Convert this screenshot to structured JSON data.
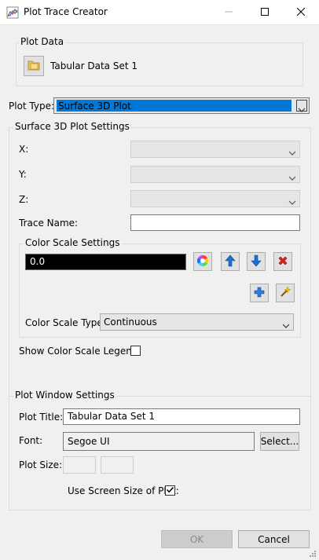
{
  "window": {
    "title": "Plot Trace Creator",
    "icon": "chart-icon",
    "controls": {
      "minimize": "minimize-icon",
      "maximize": "maximize-icon",
      "close": "close-icon"
    }
  },
  "plot_data": {
    "group_label": "Plot Data",
    "source_label": "Tabular Data Set 1",
    "source_icon": "folder-icon"
  },
  "plot_type": {
    "label": "Plot Type:",
    "value": "Surface 3D Plot"
  },
  "surface_settings": {
    "group_label": "Surface 3D Plot Settings",
    "x_label": "X:",
    "y_label": "Y:",
    "z_label": "Z:",
    "x_value": "",
    "y_value": "",
    "z_value": "",
    "trace_name_label": "Trace Name:",
    "trace_name_value": ""
  },
  "color_scale": {
    "group_label": "Color Scale Settings",
    "current_value": "0.0",
    "type_label": "Color Scale Type:",
    "type_value": "Continuous",
    "icons": {
      "color_picker": "color-wheel-icon",
      "move_up": "arrow-up-icon",
      "move_down": "arrow-down-icon",
      "remove": "red-x-icon",
      "add": "plus-icon",
      "auto": "magic-wand-icon"
    }
  },
  "legend": {
    "label": "Show Color Scale Legend:",
    "checked": false
  },
  "plot_window": {
    "group_label": "Plot Window Settings",
    "title_label": "Plot Title:",
    "title_value": "Tabular Data Set 1",
    "font_label": "Font:",
    "font_value": "Segoe UI",
    "select_label": "Select...",
    "size_label": "Plot Size:",
    "width_value": "",
    "height_value": "",
    "screen_size_label": "Use Screen Size of Plot:",
    "screen_size_checked": true
  },
  "footer": {
    "ok_label": "OK",
    "cancel_label": "Cancel"
  },
  "colors": {
    "blue_arrow": "#1f6fd0",
    "remove_red": "#d9261c",
    "folder_yellow": "#e8c45c",
    "trace_value_bg": "#000000"
  }
}
